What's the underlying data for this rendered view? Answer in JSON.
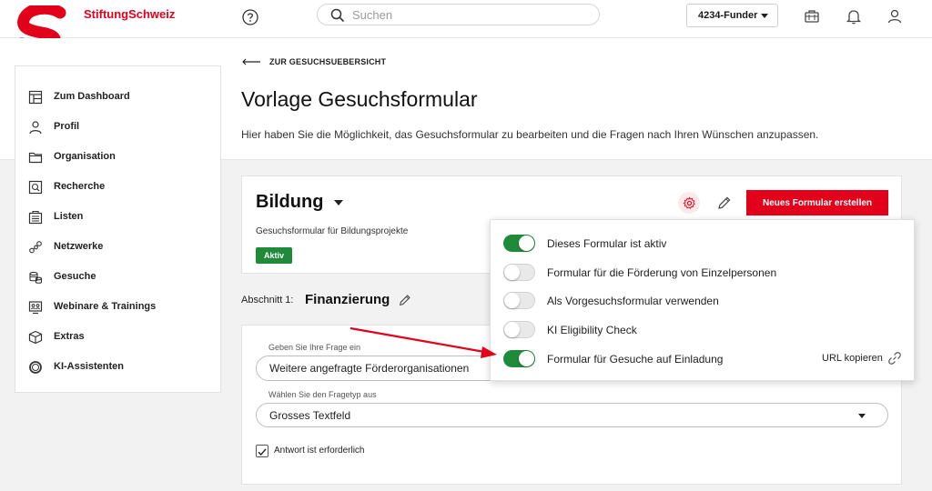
{
  "brand": {
    "name": "StiftungSchweiz",
    "color": "#e2001a"
  },
  "topbar": {
    "search_placeholder": "Suchen",
    "account_label": "4234-Funder",
    "icons": [
      "help-icon",
      "search-icon",
      "briefcase-icon",
      "bell-icon",
      "user-icon"
    ]
  },
  "sidebar": {
    "items": [
      {
        "label": "Zum Dashboard",
        "icon": "dashboard-icon"
      },
      {
        "label": "Profil",
        "icon": "user-icon"
      },
      {
        "label": "Organisation",
        "icon": "folder-icon"
      },
      {
        "label": "Recherche",
        "icon": "search-document-icon"
      },
      {
        "label": "Listen",
        "icon": "list-icon"
      },
      {
        "label": "Netzwerke",
        "icon": "network-icon"
      },
      {
        "label": "Gesuche",
        "icon": "coins-icon"
      },
      {
        "label": "Webinare & Trainings",
        "icon": "webinar-icon"
      },
      {
        "label": "Extras",
        "icon": "box-icon"
      },
      {
        "label": "KI-Assistenten",
        "icon": "ai-circle-icon"
      }
    ]
  },
  "header": {
    "back_label": "ZUR GESUCHSUEBERSICHT",
    "title": "Vorlage Gesuchsformular",
    "description": "Hier haben Sie die Möglichkeit, das Gesuchsformular zu bearbeiten und die Fragen nach Ihren Wünschen anzupassen."
  },
  "form": {
    "name": "Bildung",
    "subtitle": "Gesuchsformular für Bildungsprojekte",
    "status": "Aktiv",
    "new_form_button": "Neues Formular erstellen"
  },
  "section": {
    "prefix": "Abschnitt 1:",
    "name": "Finanzierung"
  },
  "question": {
    "question_label": "Geben Sie Ihre Frage ein",
    "question_value": "Weitere angefragte Förderorganisationen",
    "type_label": "Wählen Sie den Fragetyp aus",
    "type_value": "Grosses Textfeld",
    "required_label": "Antwort ist erforderlich",
    "required_checked": true
  },
  "settings_panel": {
    "options": [
      {
        "label": "Dieses Formular ist aktiv",
        "on": true
      },
      {
        "label": "Formular für die Förderung von Einzelpersonen",
        "on": false
      },
      {
        "label": "Als Vorgesuchsformular verwenden",
        "on": false
      },
      {
        "label": "KI Eligibility Check",
        "on": false
      },
      {
        "label": "Formular für Gesuche auf Einladung",
        "on": true
      }
    ],
    "url_copy_label": "URL kopieren"
  },
  "colors": {
    "accent": "#e2001a",
    "success": "#1e8a3a"
  }
}
